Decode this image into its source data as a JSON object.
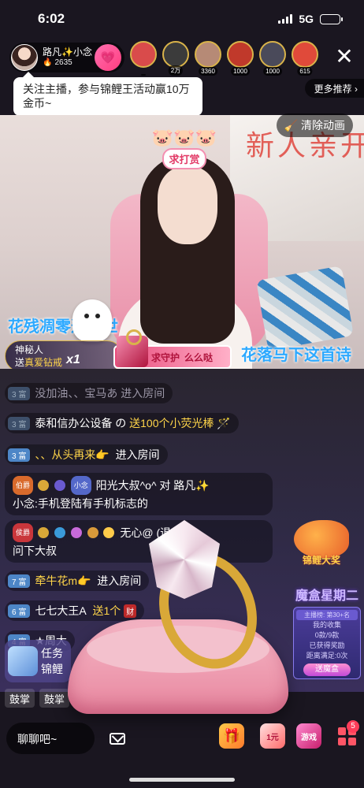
{
  "status": {
    "time": "6:02",
    "network": "5G"
  },
  "host": {
    "name": "路凡✨小念",
    "hot": "2635"
  },
  "viewers": [
    {
      "name": "viewer-1",
      "count": "",
      "color": "#d94b4b"
    },
    {
      "name": "viewer-2",
      "count": "2万",
      "color": "#3b3b3b"
    },
    {
      "name": "viewer-3",
      "count": "3360",
      "color": "#b68a76"
    },
    {
      "name": "viewer-4",
      "count": "1000",
      "color": "#c0392b"
    },
    {
      "name": "viewer-5",
      "count": "1000",
      "color": "#4a4a5a"
    },
    {
      "name": "viewer-6",
      "count": "615",
      "color": "#e04a3a"
    }
  ],
  "tooltip": "关注主播，参与锦鲤王活动赢10万金币~",
  "more_rec": "更多推荐 ›",
  "clear_anim": "清除动画",
  "reward_label": "求打赏",
  "banner_text": "新人亲开",
  "float_text_1": "花残凋零这一世",
  "float_text_2": "花落马下这首诗",
  "gift_banner": {
    "line1": "神秘人",
    "line2_prefix": "送",
    "line2_gift": "真爱钻戒",
    "count": "1"
  },
  "guard_bar": {
    "left": "求守护",
    "right": "么么哒"
  },
  "chat": {
    "r1": {
      "level": "3富",
      "text": "没加油、、宝马あ 进入房间"
    },
    "r2": {
      "level": "3富",
      "user": "泰和信办公设备",
      "mid": "の",
      "gift": "送100个小荧光棒"
    },
    "r3": {
      "level": "3富",
      "user": "、、从头再来👉",
      "action": "进入房间"
    },
    "r4": {
      "badge1": "伯爵",
      "badge2": "小念",
      "user": "阳光大叔^o^",
      "to": "对 路凡✨",
      "msg": "小念:手机登陆有手机标志的"
    },
    "r5": {
      "badge1": "侯爵",
      "user": "无心@",
      "tail": "(退)：你",
      "msg": "问下大叔"
    },
    "r6": {
      "level": "7富",
      "user": "牵牛花m👉",
      "action": "进入房间"
    },
    "r7": {
      "level": "6富",
      "user": "七七大王A",
      "gift": "送1个",
      "bag": "财"
    },
    "r8": {
      "level": "4富",
      "user": "★周大"
    }
  },
  "koi_label": "锦鲤大奖",
  "mobox": {
    "title": "魔盒星期二",
    "rank": "主播榜: 第30+名",
    "my": "我的收集",
    "my_val": "0款/9款",
    "got": "已获得奖励",
    "got_val": "距离满足:0次",
    "btn": "送魔盒"
  },
  "task": {
    "line1": "任务",
    "line2": "锦鲤"
  },
  "cheer": [
    "鼓掌",
    "鼓掌",
    "鼓掌"
  ],
  "bottom": {
    "chat_placeholder": "聊聊吧~",
    "yuan": "1元",
    "game": "游戏",
    "notif": "5"
  },
  "colors": {
    "accent": "#ff3d7f",
    "gold": "#ffd54a",
    "level_blue": "#4d86c7"
  }
}
